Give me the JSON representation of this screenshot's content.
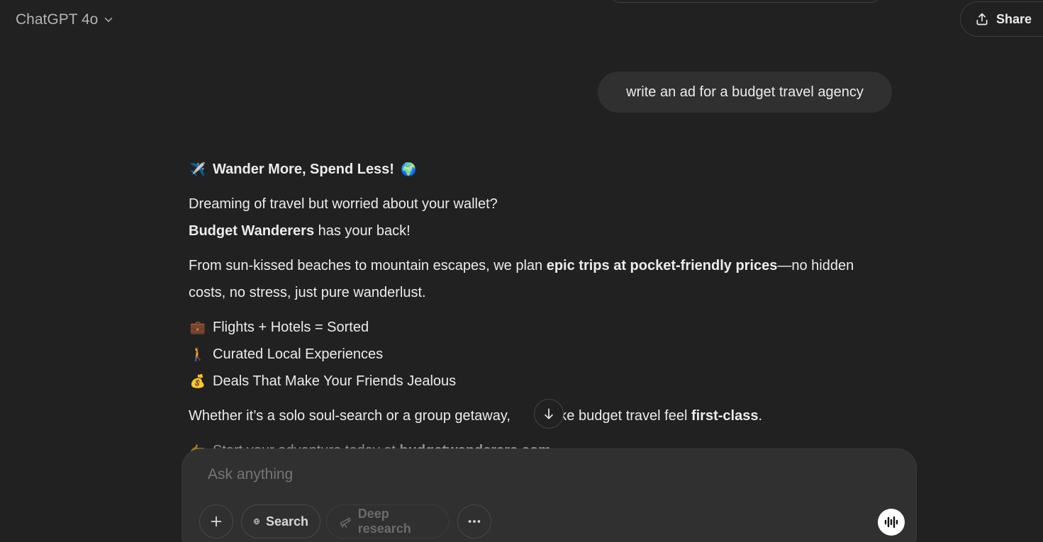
{
  "header": {
    "model_label": "ChatGPT 4o",
    "share_label": "Share"
  },
  "conversation": {
    "user_message": "write an ad for a budget travel agency",
    "assistant": {
      "headline_emoji": "✈️",
      "headline": "Wander More, Spend Less!",
      "headline_emoji_end": "🌍",
      "intro_line1": "Dreaming of travel but worried about your wallet?",
      "brand": "Budget Wanderers",
      "intro_line2_rest": " has your back!",
      "para2_start": "From sun-kissed beaches to mountain escapes, we plan ",
      "para2_bold": "epic trips at pocket-friendly prices",
      "para2_end": "—no hidden",
      "para2_line2": "costs, no stress, just pure wanderlust.",
      "features": [
        {
          "emoji": "💼",
          "text": "Flights + Hotels = Sorted"
        },
        {
          "emoji": "🚶",
          "text": "Curated Local Experiences"
        },
        {
          "emoji": "💰",
          "text": "Deals That Make Your Friends Jealous"
        }
      ],
      "closing_start": "Whether it’s a solo soul-search or a group getaway,",
      "closing_mid": "make budget travel feel ",
      "closing_bold": "first-class",
      "closing_end": ".",
      "cta_emoji": "👉",
      "cta_text": "Start your adventure today at ",
      "cta_link": "budgetwanderers.com"
    }
  },
  "composer": {
    "placeholder": "Ask anything",
    "search_label": "Search",
    "deep_research_label": "Deep research"
  },
  "icons": {
    "model_chevron": "chevron-down-icon",
    "share": "share-icon",
    "scroll": "arrow-down-icon",
    "plus": "plus-icon",
    "globe": "globe-icon",
    "telescope": "telescope-icon",
    "more": "ellipsis-icon",
    "voice": "voice-waveform-icon"
  }
}
